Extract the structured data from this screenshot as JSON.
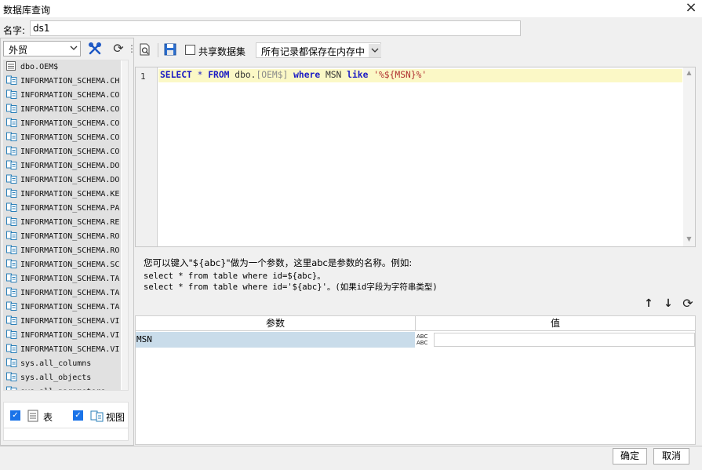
{
  "window": {
    "title": "数据库查询",
    "close_icon": "×"
  },
  "name_row": {
    "label": "名字:",
    "value": "ds1"
  },
  "left": {
    "database": "外贸",
    "tables": [
      {
        "label": "dbo.OEM$",
        "icon": "table-icon"
      },
      {
        "label": "INFORMATION_SCHEMA.CH",
        "icon": "view-icon"
      },
      {
        "label": "INFORMATION_SCHEMA.CO",
        "icon": "view-icon"
      },
      {
        "label": "INFORMATION_SCHEMA.CO",
        "icon": "view-icon"
      },
      {
        "label": "INFORMATION_SCHEMA.CO",
        "icon": "view-icon"
      },
      {
        "label": "INFORMATION_SCHEMA.CO",
        "icon": "view-icon"
      },
      {
        "label": "INFORMATION_SCHEMA.CO",
        "icon": "view-icon"
      },
      {
        "label": "INFORMATION_SCHEMA.DO",
        "icon": "view-icon"
      },
      {
        "label": "INFORMATION_SCHEMA.DO",
        "icon": "view-icon"
      },
      {
        "label": "INFORMATION_SCHEMA.KE",
        "icon": "view-icon"
      },
      {
        "label": "INFORMATION_SCHEMA.PA",
        "icon": "view-icon"
      },
      {
        "label": "INFORMATION_SCHEMA.RE",
        "icon": "view-icon"
      },
      {
        "label": "INFORMATION_SCHEMA.RO",
        "icon": "view-icon"
      },
      {
        "label": "INFORMATION_SCHEMA.RO",
        "icon": "view-icon"
      },
      {
        "label": "INFORMATION_SCHEMA.SC",
        "icon": "view-icon"
      },
      {
        "label": "INFORMATION_SCHEMA.TA",
        "icon": "view-icon"
      },
      {
        "label": "INFORMATION_SCHEMA.TA",
        "icon": "view-icon"
      },
      {
        "label": "INFORMATION_SCHEMA.TA",
        "icon": "view-icon"
      },
      {
        "label": "INFORMATION_SCHEMA.VI",
        "icon": "view-icon"
      },
      {
        "label": "INFORMATION_SCHEMA.VI",
        "icon": "view-icon"
      },
      {
        "label": "INFORMATION_SCHEMA.VI",
        "icon": "view-icon"
      },
      {
        "label": "sys.all_columns",
        "icon": "view-icon"
      },
      {
        "label": "sys.all_objects",
        "icon": "view-icon"
      },
      {
        "label": "sys.all_parameters",
        "icon": "view-icon"
      }
    ],
    "check_table_label": "表",
    "check_view_label": "视图"
  },
  "toolbar": {
    "shared_label": "共享数据集",
    "memory_select": "所有记录都保存在内存中"
  },
  "editor": {
    "line_number": "1",
    "sql": {
      "select": "SELECT",
      "star": "*",
      "from": "FROM",
      "schema": "dbo.",
      "table": "[OEM$]",
      "where": "where",
      "column": "MSN",
      "like": "like",
      "pattern": "'%${MSN}%'"
    }
  },
  "hint": {
    "line1": "您可以键入\"${abc}\"做为一个参数，这里abc是参数的名称。例如:",
    "line2": "select * from table where id=${abc}。",
    "line3": "select * from table where id='${abc}'。(如果id字段为字符串类型)"
  },
  "params": {
    "header_param": "参数",
    "header_value": "值",
    "rows": [
      {
        "name": "MSN",
        "type_top": "ABC",
        "type_bottom": "ABC",
        "value": ""
      }
    ]
  },
  "footer": {
    "ok": "确定",
    "cancel": "取消"
  },
  "colors": {
    "accent": "#1a73e8",
    "keyword": "#1a1ac4",
    "string": "#b03030",
    "row_selected": "#c9dcea",
    "line_highlight": "#fbf8c6"
  }
}
